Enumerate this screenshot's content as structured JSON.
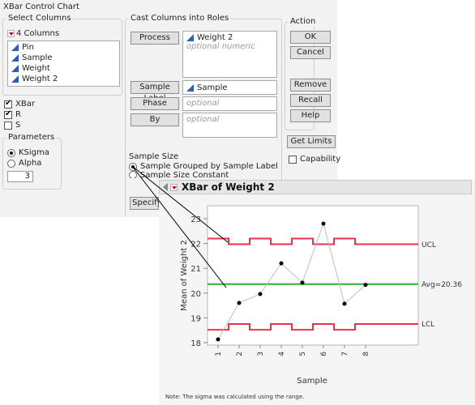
{
  "dialog": {
    "title": "XBar Control Chart",
    "select_columns": {
      "label": "Select Columns",
      "count_label": "4 Columns",
      "items": [
        {
          "name": "Pin",
          "icon": "continuous-icon"
        },
        {
          "name": "Sample",
          "icon": "continuous-icon"
        },
        {
          "name": "Weight",
          "icon": "continuous-icon"
        },
        {
          "name": "Weight 2",
          "icon": "continuous-icon"
        }
      ]
    },
    "chart_types": [
      {
        "label": "XBar",
        "checked": true
      },
      {
        "label": "R",
        "checked": true
      },
      {
        "label": "S",
        "checked": false
      }
    ],
    "parameters": {
      "label": "Parameters",
      "options": [
        {
          "label": "KSigma",
          "selected": true
        },
        {
          "label": "Alpha",
          "selected": false
        }
      ],
      "value": "3"
    },
    "roles": {
      "label": "Cast Columns into Roles",
      "process": {
        "button": "Process",
        "value": "Weight 2",
        "hint": "optional numeric"
      },
      "sample_label": {
        "button": "Sample Label",
        "value": "Sample"
      },
      "phase": {
        "button": "Phase",
        "hint": "optional"
      },
      "by": {
        "button": "By",
        "hint": "optional"
      }
    },
    "sample_size": {
      "label": "Sample Size",
      "options": [
        {
          "label": "Sample Grouped by Sample Label",
          "selected": true
        },
        {
          "label": "Sample Size Constant",
          "selected": false
        }
      ],
      "specify_button": "Specify"
    },
    "action": {
      "label": "Action",
      "ok": "OK",
      "cancel": "Cancel",
      "remove": "Remove",
      "recall": "Recall",
      "help": "Help"
    },
    "get_limits": "Get Limits",
    "capability": {
      "label": "Capability",
      "checked": false
    }
  },
  "report": {
    "title": "XBar of Weight 2",
    "note": "Note: The sigma was calculated using the range."
  },
  "chart_data": {
    "type": "line",
    "title": "XBar of Weight 2",
    "xlabel": "Sample",
    "ylabel": "Mean of Weight 2",
    "x": [
      "1",
      "2",
      "3",
      "4",
      "5",
      "6",
      "7",
      "8"
    ],
    "values": [
      18.13,
      19.6,
      19.96,
      21.2,
      20.42,
      22.8,
      19.57,
      20.33
    ],
    "ylim": [
      17.9,
      23.5
    ],
    "yticks": [
      18,
      19,
      20,
      21,
      22,
      23
    ],
    "center": {
      "label": "Avg=20.36",
      "value": 20.36
    },
    "ucl": {
      "label": "UCL",
      "values": [
        22.2,
        21.97,
        22.2,
        21.97,
        22.2,
        21.97,
        22.2,
        21.97
      ]
    },
    "lcl": {
      "label": "LCL",
      "values": [
        18.52,
        18.75,
        18.52,
        18.75,
        18.52,
        18.75,
        18.52,
        18.75
      ]
    },
    "colors": {
      "limits": "#e8334a",
      "center": "#2bb52b",
      "points": "#000000",
      "connect": "#bdbdbd"
    },
    "grid": false
  }
}
